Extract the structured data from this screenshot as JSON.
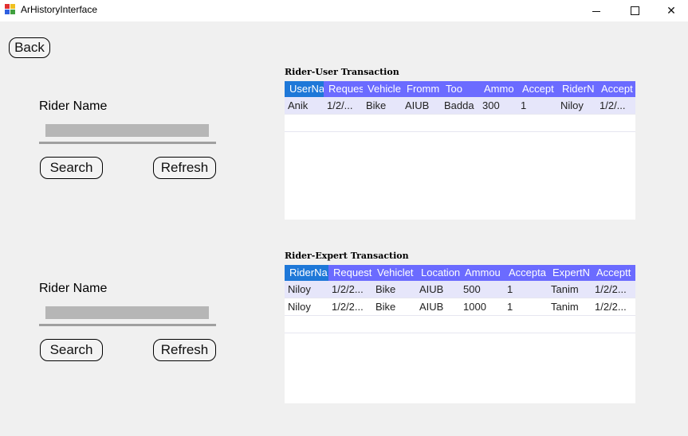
{
  "window": {
    "title": "ArHistoryInterface",
    "icon": "app-windows-icon"
  },
  "back_label": "Back",
  "user_section": {
    "label": "Rider Name",
    "input_value": "",
    "search_label": "Search",
    "refresh_label": "Refresh"
  },
  "expert_section": {
    "label": "Rider Name",
    "input_value": "",
    "search_label": "Search",
    "refresh_label": "Refresh"
  },
  "user_grid": {
    "title": "Rider-User Transaction",
    "columns": [
      "UserNa",
      "Reques",
      "Vehicle",
      "Fromm",
      "Too",
      "Ammo",
      "Accept",
      "RiderN",
      "Accept"
    ],
    "rows": [
      [
        "Anik",
        "1/2/...",
        "Bike",
        "AIUB",
        "Badda",
        "300",
        "1",
        "Niloy",
        "1/2/..."
      ]
    ]
  },
  "expert_grid": {
    "title": "Rider-Expert Transaction",
    "columns": [
      "RiderNa",
      "Request",
      "Vehiclet",
      "Location",
      "Ammou",
      "Accepta",
      "ExpertN",
      "Acceptt"
    ],
    "rows": [
      [
        "Niloy",
        "1/2/2...",
        "Bike",
        "AIUB",
        "500",
        "1",
        "Tanim",
        "1/2/2..."
      ],
      [
        "Niloy",
        "1/2/2...",
        "Bike",
        "AIUB",
        "1000",
        "1",
        "Tanim",
        "1/2/2..."
      ]
    ]
  },
  "colors": {
    "header": "#6b6bff",
    "selected_header": "#1e78d8",
    "alt_row": "#e6e6fa"
  }
}
